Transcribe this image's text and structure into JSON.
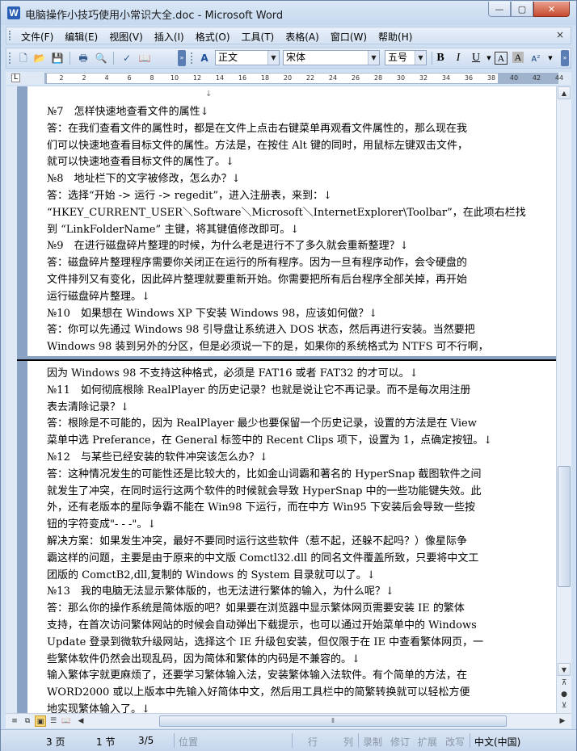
{
  "window": {
    "title": "电脑操作小技巧使用小常识大全.doc - Microsoft Word",
    "app_icon_letter": "W",
    "buttons": {
      "minimize": "—",
      "maximize": "▢",
      "close": "✕"
    }
  },
  "menu": {
    "items": [
      "文件(F)",
      "编辑(E)",
      "视图(V)",
      "插入(I)",
      "格式(O)",
      "工具(T)",
      "表格(A)",
      "窗口(W)",
      "帮助(H)"
    ],
    "close_doc": "×"
  },
  "toolbar": {
    "style_value": "正文",
    "font_value": "宋体",
    "size_value": "五号",
    "bold": "B",
    "italic": "I",
    "underline": "U",
    "char_border": "A",
    "char_shading": "A",
    "style_icon": "A"
  },
  "ruler": {
    "corner_symbol": "L",
    "ticks": [
      "2",
      "2",
      "4",
      "6",
      "8",
      "10",
      "12",
      "14",
      "16",
      "18",
      "20",
      "22",
      "24",
      "26",
      "28",
      "30",
      "32",
      "34",
      "36",
      "38",
      "40",
      "42",
      "44"
    ]
  },
  "document": {
    "page1_lines": [
      "№7　怎样快速地查看文件的属性↓",
      "答：在我们查看文件的属性时，都是在文件上点击右键菜单再观看文件属性的，那么现在我",
      "们可以快速地查看目标文件的属性。方法是，在按住 Alt 键的同时，用鼠标左键双击文件，",
      "就可以快速地查看目标文件的属性了。↓",
      "№8　地址栏下的文字被修改，怎么办？↓",
      "答：选择“开始 -> 运行 -> regedit”，进入注册表，来到：↓",
      "“HKEY_CURRENT_USER＼Software＼Microsoft＼InternetExplorer\\Toolbar”，在此项右栏找",
      "到 “LinkFolderName” 主键，将其键值修改即可。↓",
      "№9　在进行磁盘碎片整理的时候，为什么老是进行不了多久就会重新整理？↓",
      "答：磁盘碎片整理程序需要你关闭正在运行的所有程序。因为一旦有程序动作，会令硬盘的",
      "文件排列又有变化，因此碎片整理就要重新开始。你需要把所有后台程序全部关掉，再开始",
      "运行磁盘碎片整理。↓",
      "№10　如果想在 Windows XP 下安装 Windows 98，应该如何做？↓",
      "答：你可以先通过 Windows 98 引导盘让系统进入 DOS 状态，然后再进行安装。当然要把",
      "Windows 98 装到另外的分区，但是必须说一下的是，如果你的系统格式为 NTFS 可不行啊，"
    ],
    "page2_lines": [
      "因为 Windows 98 不支持这种格式，必须是 FAT16 或者 FAT32 的才可以。↓",
      "№11　如何彻底根除 RealPlayer 的历史记录？也就是说让它不再记录。而不是每次用注册",
      "表去清除记录？↓",
      "答：根除是不可能的，因为 RealPlayer 最少也要保留一个历史记录，设置的方法是在 View",
      "菜单中选 Preferance，在 General 标签中的 Recent Clips 项下，设置为 1，点确定按钮。↓",
      "№12　与某些已经安装的软件冲突该怎么办？↓",
      "答：这种情况发生的可能性还是比较大的，比如金山词霸和著名的 HyperSnap 截图软件之间",
      "就发生了冲突，在同时运行这两个软件的时候就会导致 HyperSnap 中的一些功能键失效。此",
      "外，还有老版本的星际争霸不能在 Win98 下运行，而在中方 Win95 下安装后会导致一些按",
      "钮的字符变成\"- - -\"。↓",
      "解决方案：如果发生冲突，最好不要同时运行这些软件（惹不起，还躲不起吗？）像星际争",
      "霸这样的问题，主要是由于原来的中文版 Comctl32.dll 的同名文件覆盖所致，只要将中文工",
      "团版的 ComctB2,dll,复制的 Windows 的 System 目录就可以了。↓",
      "№13　我的电脑无法显示繁体版的，也无法进行繁体的输入，为什么呢？↓",
      "答：那么你的操作系统是简体版的吧？如果要在浏览器中显示繁体网页需要安装 IE 的繁体",
      "支持，在首次访问繁体网站的时候会自动弹出下载提示，也可以通过开始菜单中的 Windows",
      "Update 登录到微软升级网站，选择这个 IE 升级包安装，但仅限于在 IE 中查看繁体网页，一",
      "些繁体软件仍然会出现乱码，因为简体和繁体的内码是不兼容的。↓",
      "输入繁体字就更麻烦了，还要学习繁体输入法，安装繁体输入法软件。有个简单的方法，在",
      "WORD2000 或以上版本中先输入好简体中文，然后用工具栏中的简繁转换就可以轻松方便",
      "地实现繁体输入了。↓"
    ]
  },
  "scrollbar": {
    "up": "▲",
    "down": "▼",
    "prev_page": "⊼",
    "browse": "●",
    "next_page": "⊻",
    "grip": "⦀"
  },
  "statusbar": {
    "page": "3 页",
    "section": "1 节",
    "page_of": "3/5",
    "position": "位置",
    "line": "行",
    "column": "列",
    "rec": "录制",
    "trk": "修订",
    "ext": "扩展",
    "ovr": "改写",
    "language": "中文(中国)"
  }
}
